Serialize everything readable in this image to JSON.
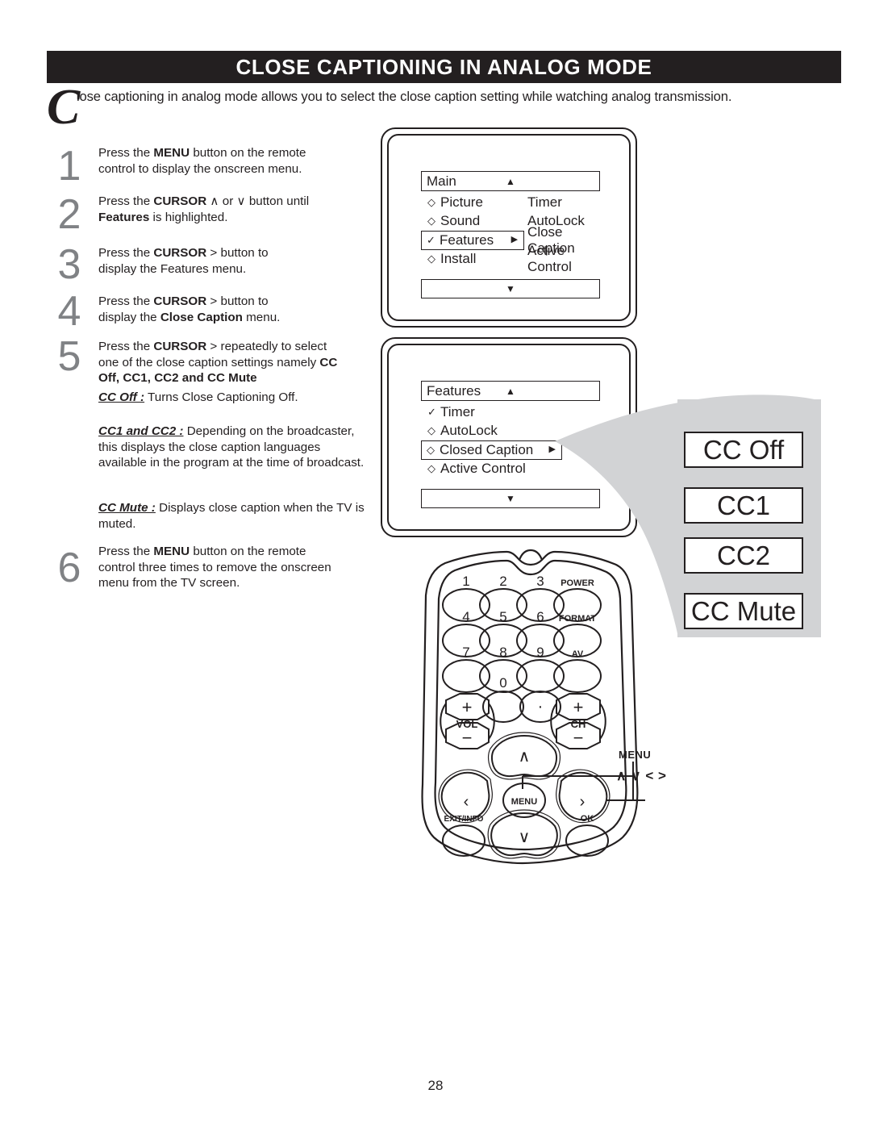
{
  "page": {
    "title": "CLOSE CAPTIONING IN ANALOG MODE",
    "number": "28",
    "intro_dropcap": "C",
    "intro_text": "lose captioning in analog mode allows you to select the close caption setting while watching analog transmission."
  },
  "steps": [
    {
      "num": "1",
      "lines": [
        [
          {
            "t": "Press the ",
            "b": false
          },
          {
            "t": "MENU",
            "b": true
          },
          {
            "t": " button on the remote",
            "b": false
          }
        ],
        [
          {
            "t": "control to display the onscreen menu.",
            "b": false
          }
        ]
      ]
    },
    {
      "num": "2",
      "lines": [
        [
          {
            "t": "Press the ",
            "b": false
          },
          {
            "t": "CURSOR",
            "b": true
          },
          {
            "t": " ∧  or ∨ button until",
            "b": false
          }
        ],
        [
          {
            "t": "Features",
            "b": true
          },
          {
            "t": " is highlighted.",
            "b": false
          }
        ]
      ]
    },
    {
      "num": "3",
      "lines": [
        [
          {
            "t": "Press the ",
            "b": false
          },
          {
            "t": "CURSOR",
            "b": true
          },
          {
            "t": " > button to",
            "b": false
          }
        ],
        [
          {
            "t": "display the Features menu.",
            "b": false
          }
        ]
      ]
    },
    {
      "num": "4",
      "lines": [
        [
          {
            "t": "Press the ",
            "b": false
          },
          {
            "t": "CURSOR",
            "b": true
          },
          {
            "t": " > button to",
            "b": false
          }
        ],
        [
          {
            "t": "display the ",
            "b": false
          },
          {
            "t": "Close Caption",
            "b": true
          },
          {
            "t": " menu.",
            "b": false
          }
        ]
      ]
    },
    {
      "num": "5",
      "lines": [
        [
          {
            "t": "Press the ",
            "b": false
          },
          {
            "t": "CURSOR",
            "b": true
          },
          {
            "t": " > repeatedly to select",
            "b": false
          }
        ],
        [
          {
            "t": "one of the close caption settings namely ",
            "b": false
          },
          {
            "t": "CC",
            "b": true
          }
        ],
        [
          {
            "t": "Off, CC1, CC2 and CC Mute",
            "b": true
          }
        ]
      ]
    },
    {
      "num": "6",
      "lines": [
        [
          {
            "t": "Press the ",
            "b": false
          },
          {
            "t": "MENU",
            "b": true
          },
          {
            "t": " button on the remote",
            "b": false
          }
        ],
        [
          {
            "t": "control three times to remove the onscreen",
            "b": false
          }
        ],
        [
          {
            "t": "menu from the TV screen.",
            "b": false
          }
        ]
      ]
    }
  ],
  "definitions": [
    {
      "lead": "CC Off :",
      "body": " Turns Close Captioning Off."
    },
    {
      "lead": "CC1 and CC2 :",
      "body": "  Depending on the broadcaster, this displays the close caption languages available in the program at the time of broadcast."
    },
    {
      "lead": "CC Mute :",
      "body": " Displays close caption when the TV is muted."
    }
  ],
  "menu_main": {
    "title": "Main",
    "up_arrow": "▲",
    "down_arrow": "▼",
    "right_arrow": "▶",
    "left_items": [
      {
        "bullet": "◇",
        "label": "Picture",
        "selected": false
      },
      {
        "bullet": "◇",
        "label": "Sound",
        "selected": false
      },
      {
        "bullet": "✓",
        "label": "Features",
        "selected": true
      },
      {
        "bullet": "◇",
        "label": "Install",
        "selected": false
      }
    ],
    "right_items": [
      "Timer",
      "AutoLock",
      "Close Caption",
      "Active Control"
    ]
  },
  "menu_features": {
    "title": "Features",
    "up_arrow": "▲",
    "down_arrow": "▼",
    "right_arrow": "▶",
    "left_items": [
      {
        "bullet": "✓",
        "label": "Timer",
        "selected": false
      },
      {
        "bullet": "◇",
        "label": "AutoLock",
        "selected": false
      },
      {
        "bullet": "◇",
        "label": "Closed Caption",
        "selected": true
      },
      {
        "bullet": "◇",
        "label": "Active Control",
        "selected": false
      }
    ],
    "right_items": []
  },
  "cc_options": [
    {
      "label": "CC Off"
    },
    {
      "label": "CC1"
    },
    {
      "label": "CC2"
    },
    {
      "label": "CC Mute"
    }
  ],
  "remote": {
    "keys_row1": [
      "1",
      "2",
      "3"
    ],
    "keys_row2": [
      "4",
      "5",
      "6"
    ],
    "keys_row3": [
      "7",
      "8",
      "9"
    ],
    "power": "POWER",
    "format": "FORMAT",
    "av": "AV",
    "zero": "0",
    "vol": "VOL",
    "ch": "CH",
    "plus": "+",
    "minus": "−",
    "menu_key": "MENU",
    "exit_info": "EXIT/INFO",
    "ok": "OK",
    "up_glyph": "∧",
    "down_glyph": "∨",
    "left_glyph": "‹",
    "right_glyph": "›",
    "callout_menu": "MENU",
    "callout_cursor": "∧ ∨ < >"
  },
  "colors": {
    "header_bg": "#231f20",
    "ink": "#231f20",
    "step_number": "#808285",
    "swoosh": "#d2d3d5"
  }
}
